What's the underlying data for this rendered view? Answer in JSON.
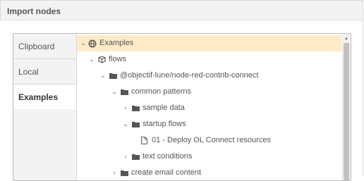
{
  "dialog": {
    "title": "Import nodes"
  },
  "tabs": [
    {
      "label": "Clipboard",
      "active": false
    },
    {
      "label": "Local",
      "active": false
    },
    {
      "label": "Examples",
      "active": true
    }
  ],
  "tree": [
    {
      "label": "Examples",
      "icon": "globe-icon",
      "chevron": "down",
      "selected": true
    },
    {
      "label": "flows",
      "icon": "cube-icon",
      "chevron": "down"
    },
    {
      "label": "@objectif-lune/node-red-contrib-connect",
      "icon": "folder-icon",
      "chevron": "down"
    },
    {
      "label": "common patterns",
      "icon": "folder-icon",
      "chevron": "down"
    },
    {
      "label": "sample data",
      "icon": "folder-icon",
      "chevron": "right"
    },
    {
      "label": "startup flows",
      "icon": "folder-icon",
      "chevron": "down"
    },
    {
      "label": "01 - Deploy OL Connect resources",
      "icon": "file-icon",
      "chevron": ""
    },
    {
      "label": "text conditions",
      "icon": "folder-icon",
      "chevron": "right"
    },
    {
      "label": "create email content",
      "icon": "folder-icon",
      "chevron": "right"
    }
  ],
  "colors": {
    "selected_row": "#ffebc7",
    "panel_bg": "#f3f3f3",
    "text": "#555555"
  }
}
